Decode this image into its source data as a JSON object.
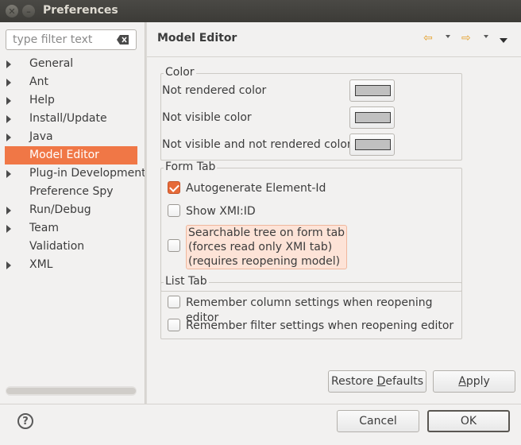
{
  "window": {
    "title": "Preferences"
  },
  "filter": {
    "placeholder": "type filter text"
  },
  "tree": [
    {
      "label": "General",
      "expandable": true,
      "selected": false
    },
    {
      "label": "Ant",
      "expandable": true,
      "selected": false
    },
    {
      "label": "Help",
      "expandable": true,
      "selected": false
    },
    {
      "label": "Install/Update",
      "expandable": true,
      "selected": false
    },
    {
      "label": "Java",
      "expandable": true,
      "selected": false
    },
    {
      "label": "Model Editor",
      "expandable": false,
      "selected": true
    },
    {
      "label": "Plug-in Development",
      "expandable": true,
      "selected": false
    },
    {
      "label": "Preference Spy",
      "expandable": false,
      "selected": false
    },
    {
      "label": "Run/Debug",
      "expandable": true,
      "selected": false
    },
    {
      "label": "Team",
      "expandable": true,
      "selected": false
    },
    {
      "label": "Validation",
      "expandable": false,
      "selected": false
    },
    {
      "label": "XML",
      "expandable": true,
      "selected": false
    }
  ],
  "page": {
    "title": "Model Editor",
    "color_group": {
      "label": "Color",
      "rows": [
        {
          "label": "Not rendered color",
          "swatch": "#c0c0c0"
        },
        {
          "label": "Not visible color",
          "swatch": "#c0c0c0"
        },
        {
          "label": "Not visible and not rendered color",
          "swatch": "#c0c0c0"
        }
      ]
    },
    "form_tab_group": {
      "label": "Form Tab",
      "options": [
        {
          "label": "Autogenerate Element-Id",
          "checked": true
        },
        {
          "label": "Show XMI:ID",
          "checked": false
        },
        {
          "label": "Searchable tree on form tab\n(forces read only XMI tab)\n(requires reopening model)",
          "checked": false
        }
      ]
    },
    "list_tab_group": {
      "label": "List Tab",
      "options": [
        {
          "label": "Remember column settings when reopening editor",
          "checked": false
        },
        {
          "label": "Remember filter settings when reopening editor",
          "checked": false
        }
      ]
    },
    "restore_defaults": {
      "label_pre": "Restore ",
      "label_mnemonic": "D",
      "label_post": "efaults"
    },
    "apply": {
      "label_mnemonic": "A",
      "label_post": "pply"
    }
  },
  "footer": {
    "cancel_label": "Cancel",
    "ok_label": "OK"
  },
  "colors": {
    "accent": "#f07746",
    "checkbox_checked": "#e66a38",
    "highlight": "#fde3d7"
  }
}
